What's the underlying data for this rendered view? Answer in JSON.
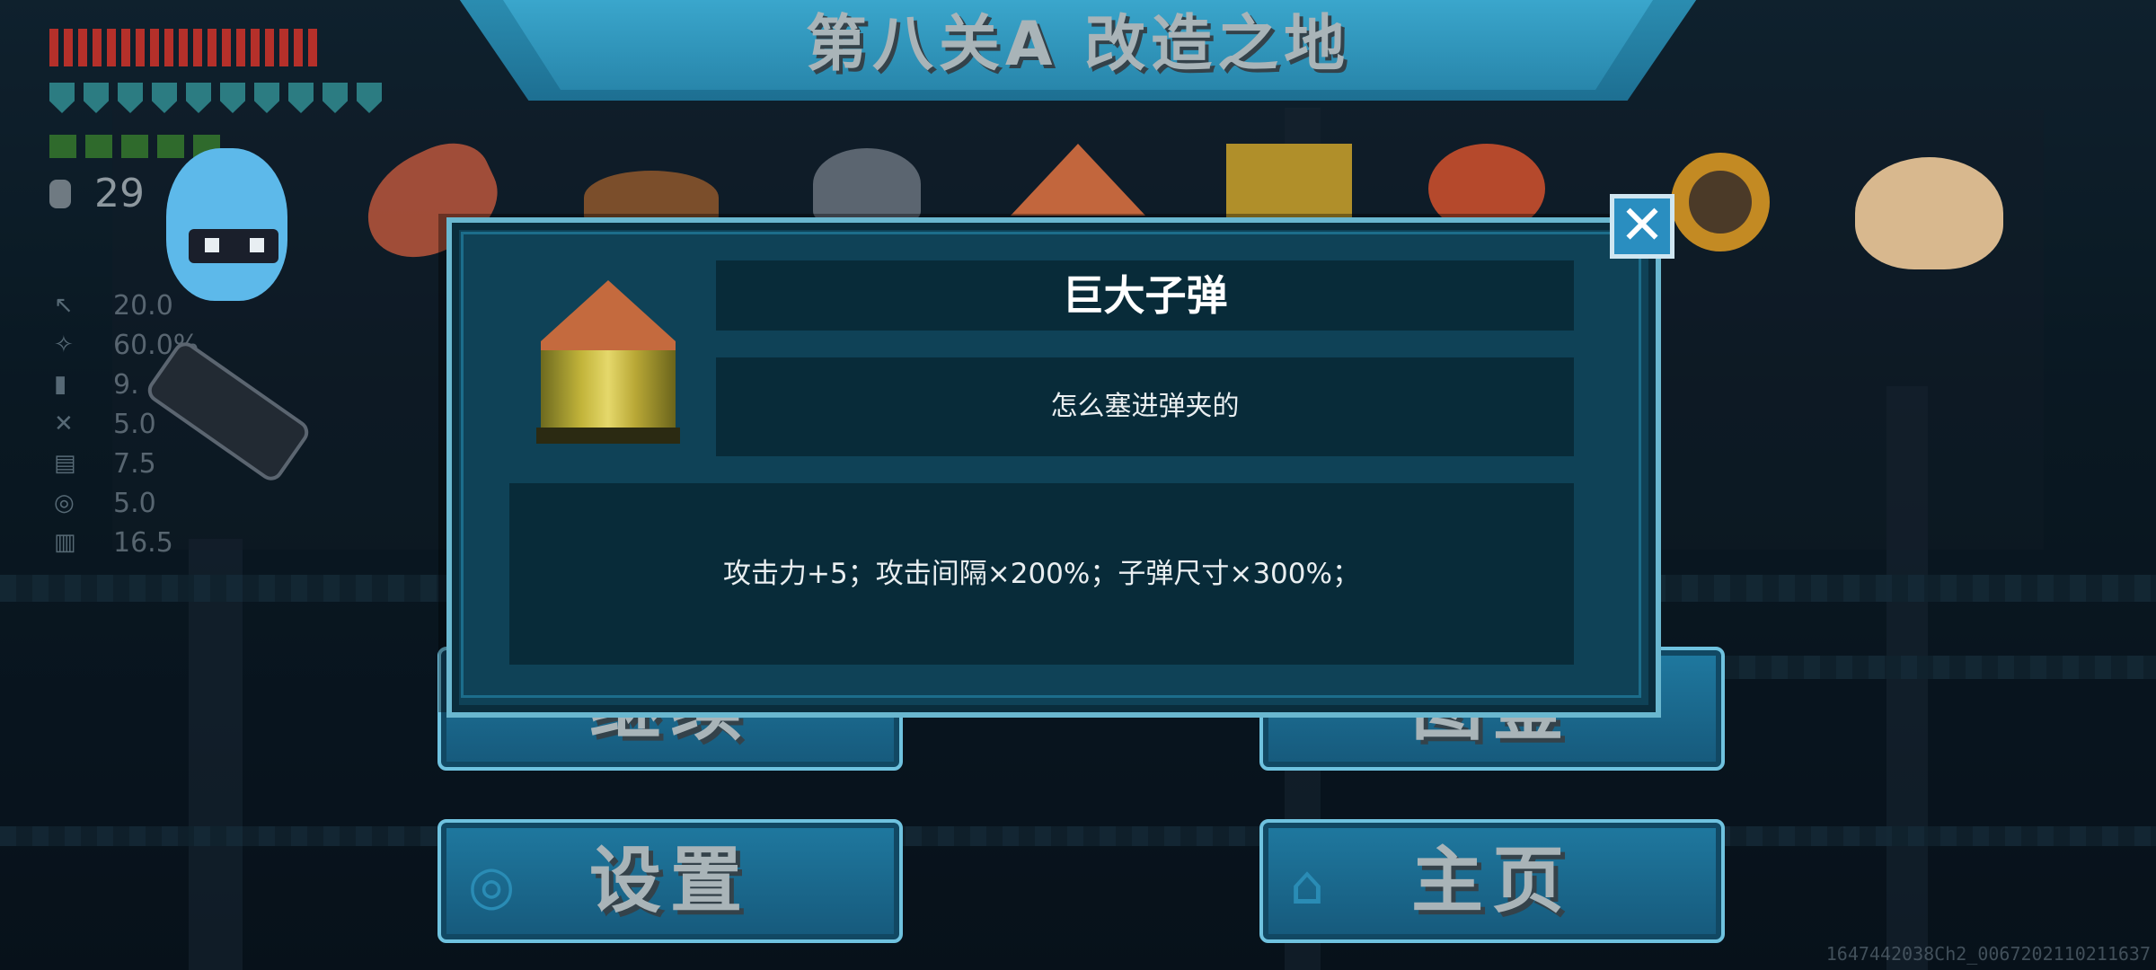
{
  "level_title": "第八关A  改造之地",
  "hud": {
    "coin_count": "29",
    "stats": [
      {
        "icon": "attack-icon",
        "value": "20.0"
      },
      {
        "icon": "crit-icon",
        "value": "60.0%"
      },
      {
        "icon": "speed-icon",
        "value": "9."
      },
      {
        "icon": "range-icon",
        "value": "5.0"
      },
      {
        "icon": "interval-icon",
        "value": "7.5"
      },
      {
        "icon": "bullet-speed-icon",
        "value": "5.0"
      },
      {
        "icon": "size-icon",
        "value": "16.5"
      }
    ]
  },
  "buttons": {
    "continue_label": "继续",
    "collection_label": "图鉴",
    "settings_label": "设置",
    "home_label": "主页"
  },
  "modal": {
    "item_name": "巨大子弹",
    "item_desc": "怎么塞进弹夹的",
    "item_effect": "攻击力+5；攻击间隔×200%；子弹尺寸×300%；",
    "close_symbol": "✕"
  },
  "watermark": "1647442038Ch2_0067202110211637"
}
